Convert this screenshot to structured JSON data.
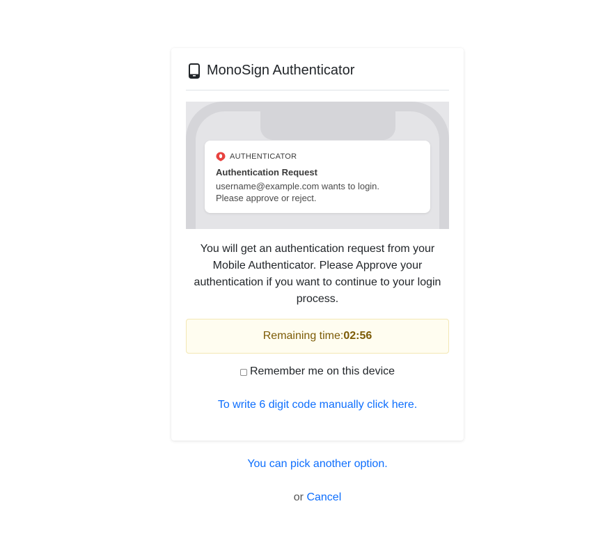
{
  "header": {
    "title": "MonoSign Authenticator",
    "icon": "mobile-phone-icon"
  },
  "notification": {
    "app_icon": "authenticator-logo-icon",
    "app_name": "AUTHENTICATOR",
    "title": "Authentication Request",
    "line1": "username@example.com wants to login.",
    "line2": "Please approve or reject."
  },
  "description": "You will get an authentication request from your Mobile Authenticator. Please Approve your authentication if you want to continue to your login process.",
  "timer": {
    "label": "Remaining time:",
    "value": "02:56"
  },
  "remember": {
    "label": "Remember me on this device",
    "checked": false
  },
  "links": {
    "manual_code": "To write 6 digit code manually click here.",
    "another_option": "You can pick another option.",
    "or_text": "or",
    "cancel": "Cancel"
  },
  "colors": {
    "link": "#0d6efd",
    "warning_bg": "#fffdf0",
    "warning_text": "#7c5b06",
    "brand_red": "#e8423f"
  }
}
